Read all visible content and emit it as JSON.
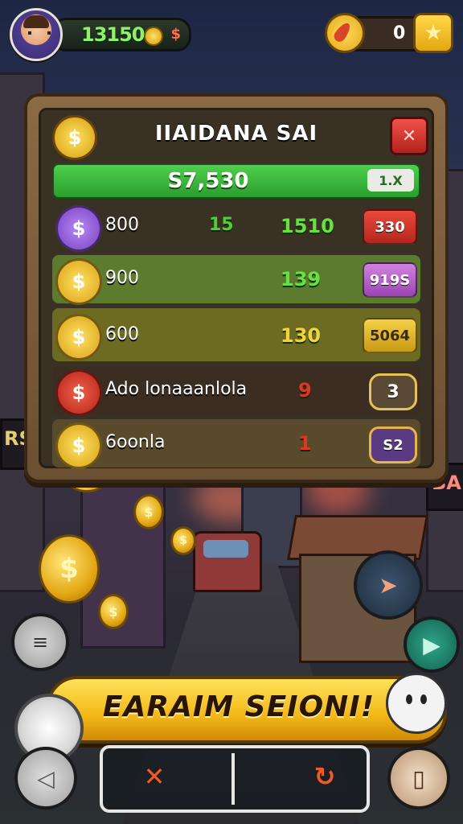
{
  "hud": {
    "money": "13150",
    "money_symbol": "$",
    "gems": "0",
    "star_icon": "★"
  },
  "panel": {
    "title": "IIAIDANA SAI",
    "close_label": "✕",
    "header_coin": "$",
    "balance": "S7,530",
    "multiplier": "1.X",
    "rows": [
      {
        "coin_symbol": "$",
        "label": "800",
        "v1": "15",
        "v2": "1510",
        "btn": "330"
      },
      {
        "coin_symbol": "$",
        "label": "900",
        "v1": "",
        "v2": "139",
        "btn": "919S"
      },
      {
        "coin_symbol": "$",
        "label": "600",
        "v1": "",
        "v2": "130",
        "btn": "5064"
      },
      {
        "coin_symbol": "$",
        "label": "Ado lonaaanlola",
        "v1": "",
        "v2": "9",
        "btn": "3"
      },
      {
        "coin_symbol": "$",
        "label": "6oonla",
        "v1": "",
        "v2": "1",
        "btn": "S2"
      }
    ]
  },
  "scene": {
    "sign_left": "RS",
    "sign_right": "BA"
  },
  "banner": {
    "text": "EARAIM SEIONI!"
  },
  "controls": {
    "cancel_icon": "✕",
    "retry_icon": "↻",
    "back_icon": "◁",
    "book_icon": "▯",
    "action_icon": "➤",
    "play_icon": "▶",
    "menu_icon": "≡"
  },
  "colors": {
    "row_coins": [
      "#8e58d6",
      "#e8b71b",
      "#e8b71b",
      "#d9301f",
      "#e8b71b"
    ],
    "row_bgs": [
      "#3a3125",
      "#5c7b2f",
      "#6d6a22",
      "#3b2d22",
      "#5a4a2c"
    ],
    "row_btns": [
      "#d0362b",
      "#b95fc8",
      "#e1b728",
      "#6a5638",
      "#6a3d8a"
    ]
  }
}
